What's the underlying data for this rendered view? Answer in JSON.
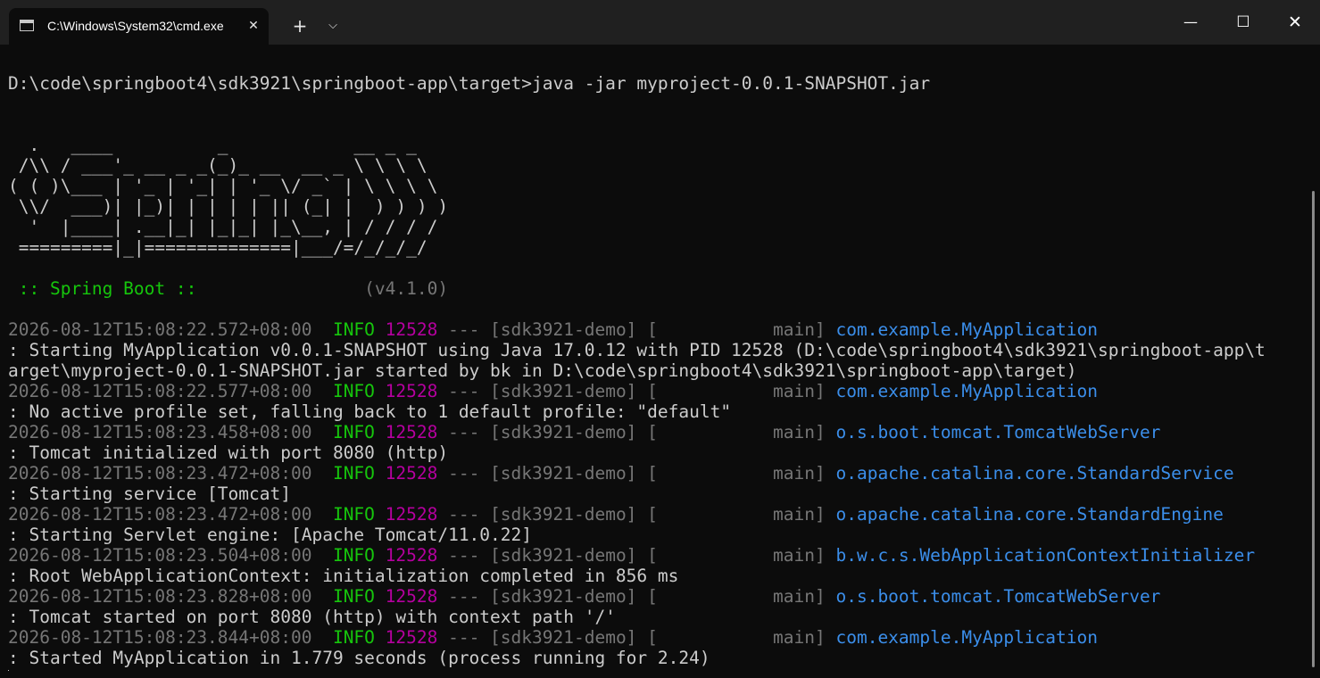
{
  "window": {
    "tab_title": "C:\\Windows\\System32\\cmd.exe",
    "tab_close": "✕",
    "new_tab": "+",
    "dropdown": "⌵",
    "minimize": "—",
    "maximize": "☐",
    "close": "✕"
  },
  "colors": {
    "background": "#0c0c0c",
    "titlebar": "#202020",
    "text": "#cccccc",
    "dim": "#767676",
    "green": "#16c60c",
    "magenta": "#b4009e",
    "blue": "#3b8eea"
  },
  "terminal": {
    "prompt": "D:\\code\\springboot4\\sdk3921\\springboot-app\\target>java -jar myproject-0.0.1-SNAPSHOT.jar",
    "banner": [
      "  .   ____          _            __ _ _",
      " /\\\\ / ___'_ __ _ _(_)_ __  __ _ \\ \\ \\ \\",
      "( ( )\\___ | '_ | '_| | '_ \\/ _` | \\ \\ \\ \\",
      " \\\\/  ___)| |_)| | | | | || (_| |  ) ) ) )",
      "  '  |____| .__|_| |_|_| |_\\__, | / / / /",
      " =========|_|==============|___/=/_/_/_/"
    ],
    "spring_label": " :: Spring Boot :: ",
    "spring_version": "               (v4.1.0)",
    "logs": [
      {
        "ts": "2026-08-12T15:08:22.572+08:00  ",
        "level": "INFO",
        "pid": "12528",
        "sep": " --- [sdk3921-demo] [           main] ",
        "logger": "com.example.MyApplication",
        "msg": [
          ": Starting MyApplication v0.0.1-SNAPSHOT using Java 17.0.12 with PID 12528 (D:\\code\\springboot4\\sdk3921\\springboot-app\\t",
          "arget\\myproject-0.0.1-SNAPSHOT.jar started by bk in D:\\code\\springboot4\\sdk3921\\springboot-app\\target)"
        ]
      },
      {
        "ts": "2026-08-12T15:08:22.577+08:00  ",
        "level": "INFO",
        "pid": "12528",
        "sep": " --- [sdk3921-demo] [           main] ",
        "logger": "com.example.MyApplication",
        "msg": [
          ": No active profile set, falling back to 1 default profile: \"default\""
        ]
      },
      {
        "ts": "2026-08-12T15:08:23.458+08:00  ",
        "level": "INFO",
        "pid": "12528",
        "sep": " --- [sdk3921-demo] [           main] ",
        "logger": "o.s.boot.tomcat.TomcatWebServer",
        "msg": [
          ": Tomcat initialized with port 8080 (http)"
        ]
      },
      {
        "ts": "2026-08-12T15:08:23.472+08:00  ",
        "level": "INFO",
        "pid": "12528",
        "sep": " --- [sdk3921-demo] [           main] ",
        "logger": "o.apache.catalina.core.StandardService",
        "msg": [
          ": Starting service [Tomcat]"
        ]
      },
      {
        "ts": "2026-08-12T15:08:23.472+08:00  ",
        "level": "INFO",
        "pid": "12528",
        "sep": " --- [sdk3921-demo] [           main] ",
        "logger": "o.apache.catalina.core.StandardEngine",
        "msg": [
          ": Starting Servlet engine: [Apache Tomcat/11.0.22]"
        ]
      },
      {
        "ts": "2026-08-12T15:08:23.504+08:00  ",
        "level": "INFO",
        "pid": "12528",
        "sep": " --- [sdk3921-demo] [           main] ",
        "logger": "b.w.c.s.WebApplicationContextInitializer",
        "msg": [
          ": Root WebApplicationContext: initialization completed in 856 ms"
        ]
      },
      {
        "ts": "2026-08-12T15:08:23.828+08:00  ",
        "level": "INFO",
        "pid": "12528",
        "sep": " --- [sdk3921-demo] [           main] ",
        "logger": "o.s.boot.tomcat.TomcatWebServer",
        "msg": [
          ": Tomcat started on port 8080 (http) with context path '/'"
        ]
      },
      {
        "ts": "2026-08-12T15:08:23.844+08:00  ",
        "level": "INFO",
        "pid": "12528",
        "sep": " --- [sdk3921-demo] [           main] ",
        "logger": "com.example.MyApplication",
        "msg": [
          ": Started MyApplication in 1.779 seconds (process running for 2.24)"
        ]
      }
    ]
  }
}
